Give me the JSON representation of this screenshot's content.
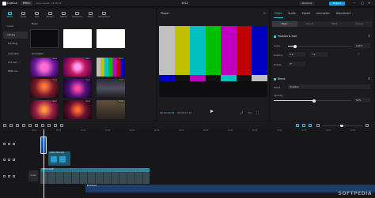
{
  "titlebar": {
    "app_name": "CapCut",
    "menu_label": "Menu",
    "autosave": "Auto saved: 14:58:21",
    "window_title": "1012",
    "shortcut_label": "Shortcut",
    "export_label": "Export",
    "controls": [
      "–",
      "□",
      "✕"
    ]
  },
  "media": {
    "tools": [
      {
        "label": "Media",
        "icon": "media-icon"
      },
      {
        "label": "Audio",
        "icon": "audio-icon"
      },
      {
        "label": "Text",
        "icon": "text-icon"
      },
      {
        "label": "Stickers",
        "icon": "stickers-icon"
      },
      {
        "label": "Effects",
        "icon": "effects-icon"
      },
      {
        "label": "Transitions",
        "icon": "transitions-icon"
      },
      {
        "label": "Filters",
        "icon": "filters-icon"
      },
      {
        "label": "Adjustment",
        "icon": "adjustment-icon"
      }
    ],
    "sidebar": [
      "• Local",
      "• Library",
      "Trending",
      "Animation",
      "Cut rout ...",
      "BGM, Ca..."
    ],
    "section_basic": "Basic",
    "section_animation": "Animation",
    "durations": [
      "",
      "",
      "",
      "00:00",
      "00:01",
      "00:02",
      "00:04",
      "00:05",
      "00:00",
      "00:05",
      "00:10",
      "00:04"
    ]
  },
  "player": {
    "title": "Player",
    "current_time": "00:00:00:16",
    "total_time": "00:00:47:15",
    "color_bars": [
      "#c0c0c0",
      "#c0c000",
      "#00c0c0",
      "#00c000",
      "#c000c0",
      "#c00000",
      "#0000c0"
    ],
    "mid_bars": [
      "#0000c0",
      "#131313",
      "#c000c0",
      "#131313",
      "#00c0c0",
      "#131313",
      "#c0c0c0"
    ],
    "bottom_bars": [
      "#00214c",
      "#ffffff",
      "#32006a",
      "#131313",
      "#090909",
      "#131313",
      "#1d1d1d"
    ]
  },
  "properties": {
    "tabs": [
      "Video",
      "Audio",
      "Speed",
      "Animation",
      "Adjustment"
    ],
    "subtabs": [
      "Basic",
      "Cutout",
      "Mask",
      "Canvas"
    ],
    "position_size": "Position & Size",
    "scale_label": "Scale",
    "scale_value": "110%",
    "scale_level": 0.11,
    "position_label": "Position",
    "pos_x": "X 0",
    "pos_y": "Y 0",
    "rotate_label": "Rotate",
    "rotate_value": "0°",
    "blend": "Blend",
    "mode_label": "Mode",
    "mode_value": "Brighten",
    "opacity_label": "Opacity",
    "opacity_value": "52%",
    "opacity_level": 0.52
  },
  "timeline": {
    "ruler": [
      "00:00",
      "00:05",
      "00:10",
      "00:15",
      "00:20",
      "00:25",
      "00:30",
      "00:35",
      "00:40",
      "00:45",
      "00:50",
      "00:55",
      "01:00",
      "01:05"
    ],
    "clip_sticker": "Subscribe Logo",
    "clip_main": "dyimsmaGIF",
    "clip_audio": "Brokeback",
    "cover_label": "Cover"
  },
  "watermark": "SOFTPEDIA"
}
